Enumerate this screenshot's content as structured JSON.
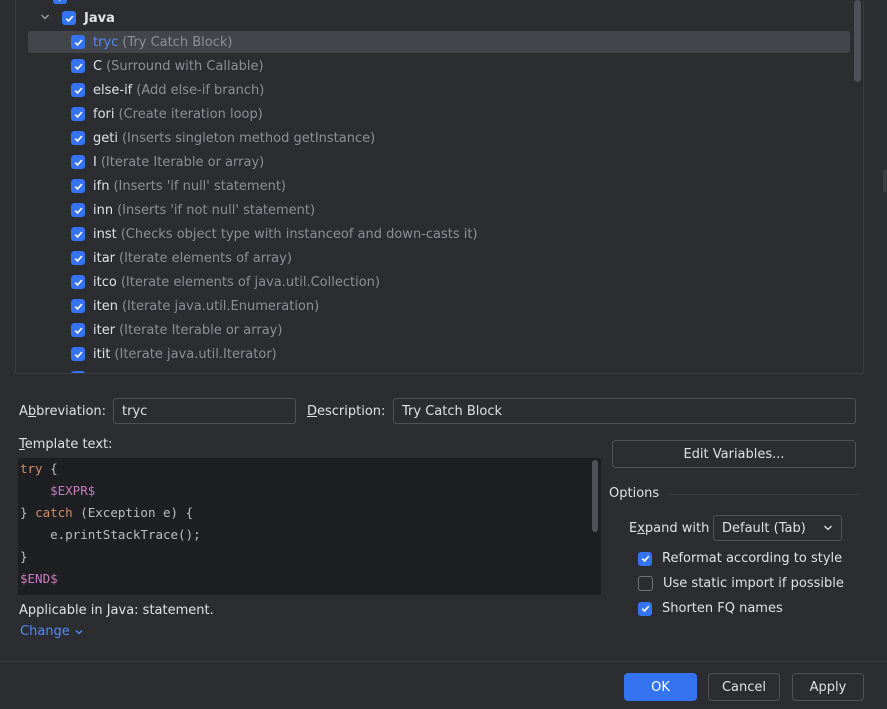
{
  "tree": {
    "group": {
      "name": "Java",
      "checked": true
    },
    "items": [
      {
        "abbr": "tryc",
        "desc": "(Try Catch Block)",
        "selected": true
      },
      {
        "abbr": "C",
        "desc": "(Surround with Callable)"
      },
      {
        "abbr": "else-if",
        "desc": "(Add else-if branch)"
      },
      {
        "abbr": "fori",
        "desc": "(Create iteration loop)"
      },
      {
        "abbr": "geti",
        "desc": "(Inserts singleton method getInstance)"
      },
      {
        "abbr": "I",
        "desc": "(Iterate Iterable or array)"
      },
      {
        "abbr": "ifn",
        "desc": "(Inserts 'if null' statement)"
      },
      {
        "abbr": "inn",
        "desc": "(Inserts 'if not null' statement)"
      },
      {
        "abbr": "inst",
        "desc": "(Checks object type with instanceof and down-casts it)"
      },
      {
        "abbr": "itar",
        "desc": "(Iterate elements of array)"
      },
      {
        "abbr": "itco",
        "desc": "(Iterate elements of java.util.Collection)"
      },
      {
        "abbr": "iten",
        "desc": "(Iterate java.util.Enumeration)"
      },
      {
        "abbr": "iter",
        "desc": "(Iterate Iterable or array)"
      },
      {
        "abbr": "itit",
        "desc": "(Iterate java.util.Iterator)"
      }
    ]
  },
  "form": {
    "abbreviation_label_pre": "A",
    "abbreviation_label_u": "b",
    "abbreviation_label_post": "breviation:",
    "abbreviation_value": "tryc",
    "description_label_u": "D",
    "description_label_post": "escription:",
    "description_value": "Try Catch Block",
    "template_label_u": "T",
    "template_label_post": "emplate text:",
    "edit_variables": "Edit Variables...",
    "applicable": "Applicable in Java: statement.",
    "change": "Change"
  },
  "template": {
    "l1_kw": "try",
    "l1_rest": " {",
    "l2_var": "$EXPR$",
    "l3_a": "} ",
    "l3_kw": "catch",
    "l3_rest": " (Exception e) {",
    "l4": "e.printStackTrace();",
    "l5": "}",
    "l6_var": "$END$"
  },
  "options": {
    "title": "Options",
    "expand_label_pre": "E",
    "expand_label_u": "x",
    "expand_label_post": "pand with",
    "expand_value": "Default (Tab)",
    "reformat": {
      "label": "Reformat according to style",
      "checked": true
    },
    "static_import": {
      "label": "Use static import if possible",
      "checked": false
    },
    "shorten_fq": {
      "label": "Shorten FQ names",
      "checked": true
    }
  },
  "buttons": {
    "ok": "OK",
    "cancel": "Cancel",
    "apply": "Apply"
  },
  "colors": {
    "accent": "#3574f0",
    "link": "#548af7",
    "keyword": "#cf8e6d",
    "template_var": "#c77dbb"
  }
}
